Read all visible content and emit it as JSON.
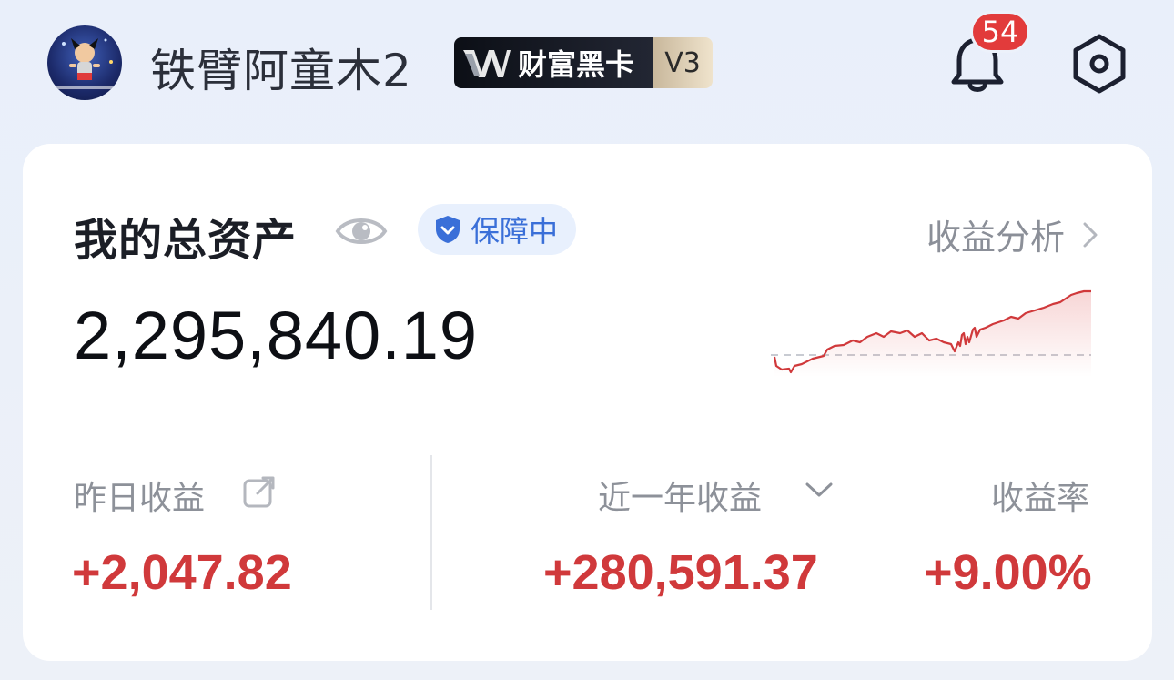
{
  "header": {
    "username": "铁臂阿童木2",
    "vip_label": "财富黑卡",
    "vip_level": "V3",
    "notification_count": "54"
  },
  "card": {
    "title": "我的总资产",
    "protect_label": "保障中",
    "analysis_link": "收益分析",
    "total_assets": "2,295,840.19",
    "yesterday_label": "昨日收益",
    "yesterday_value": "+2,047.82",
    "period_label": "近一年收益",
    "period_value": "+280,591.37",
    "rate_label": "收益率",
    "rate_value": "+9.00%"
  },
  "colors": {
    "positive": "#d0393b",
    "accent_blue": "#3a6fd8"
  }
}
